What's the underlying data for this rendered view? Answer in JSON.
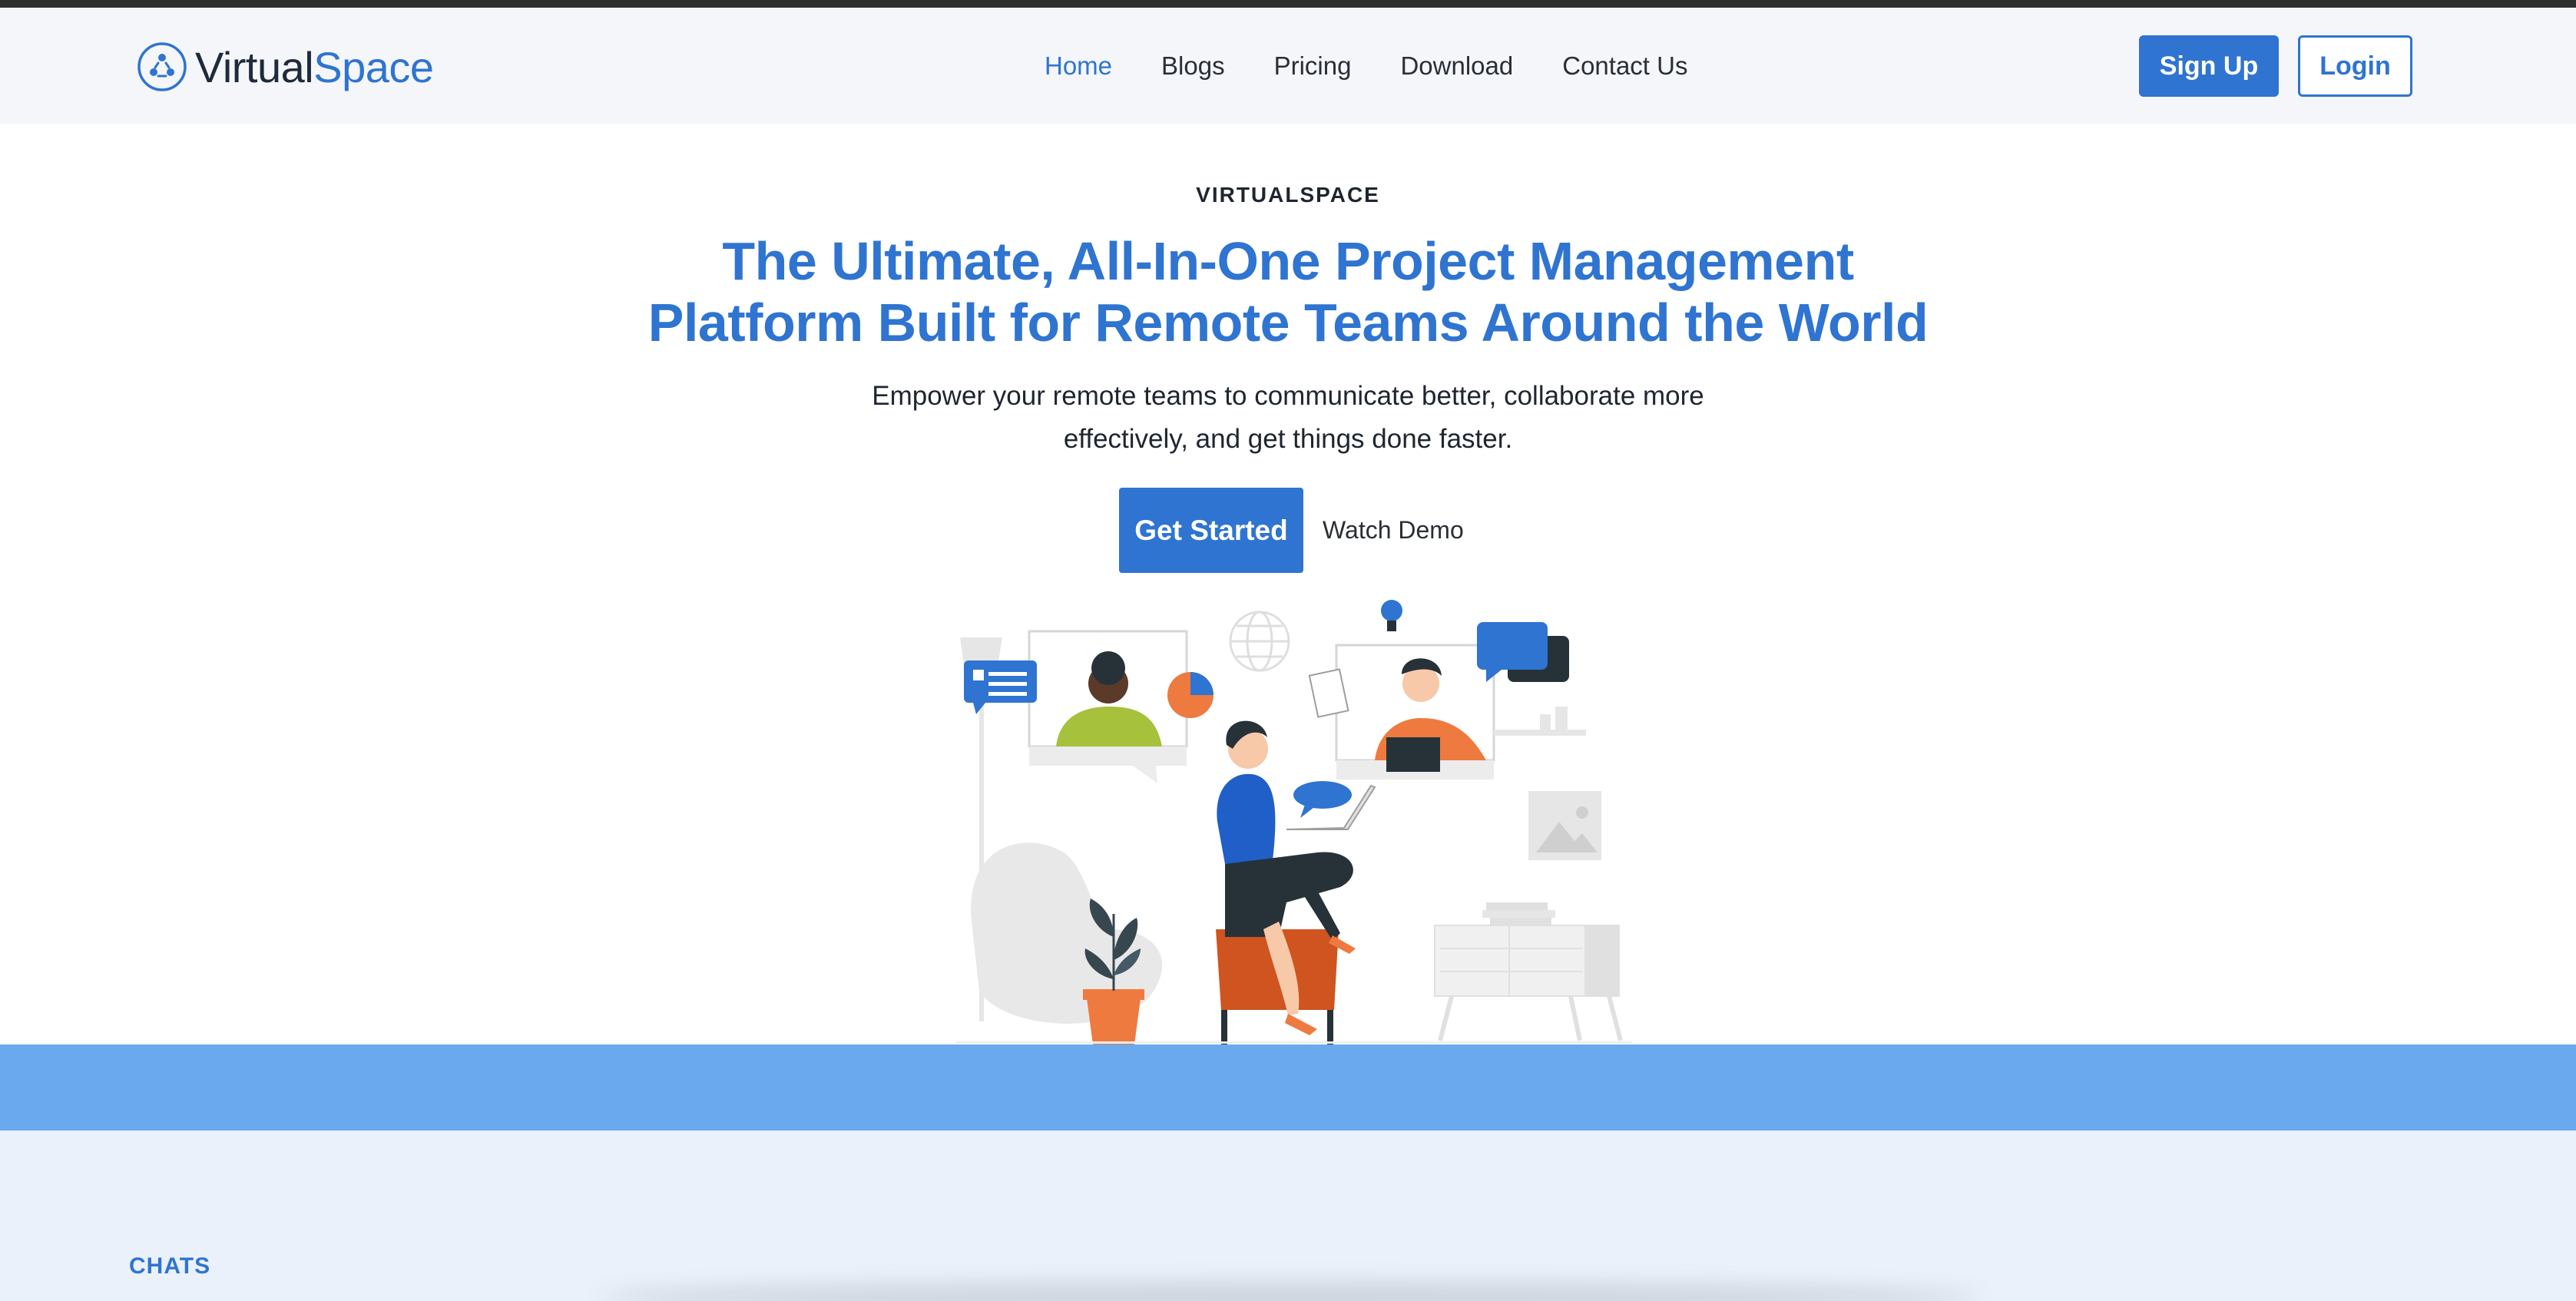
{
  "brand": {
    "name_part1": "Virtual",
    "name_part2": "Space",
    "primary_color": "#2f74d0"
  },
  "nav": {
    "items": [
      {
        "label": "Home",
        "active": true
      },
      {
        "label": "Blogs",
        "active": false
      },
      {
        "label": "Pricing",
        "active": false
      },
      {
        "label": "Download",
        "active": false
      },
      {
        "label": "Contact Us",
        "active": false
      }
    ]
  },
  "auth": {
    "signup_label": "Sign Up",
    "login_label": "Login"
  },
  "hero": {
    "eyebrow": "VIRTUALSPACE",
    "headline_line1": "The Ultimate, All-In-One Project Management",
    "headline_line2": "Platform Built for Remote Teams Around the World",
    "subtext_line1": "Empower your remote teams to communicate better, collaborate more",
    "subtext_line2": "effectively, and get things done faster.",
    "cta_primary": "Get Started",
    "cta_secondary": "Watch Demo"
  },
  "next_section": {
    "label": "CHATS",
    "band_color": "#6aa9ee"
  }
}
